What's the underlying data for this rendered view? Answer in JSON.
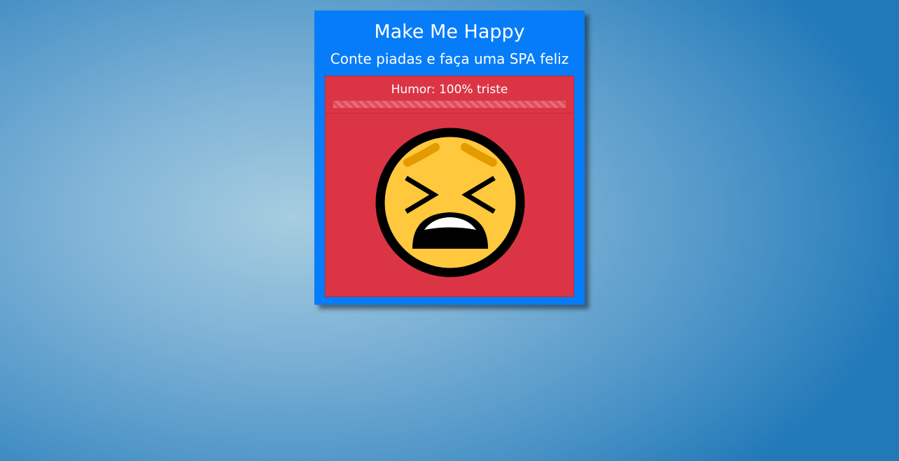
{
  "app": {
    "title": "Make Me Happy",
    "subtitle": "Conte piadas e faça uma SPA feliz"
  },
  "mood": {
    "label": "Humor: 100% triste",
    "sad_percent": 100,
    "face_icon": "tired-face-icon"
  },
  "colors": {
    "card_background": "#067cf9",
    "panel_background": "#db3545",
    "face_yellow": "#ffc83d",
    "eyebrow_orange": "#e39b00"
  }
}
